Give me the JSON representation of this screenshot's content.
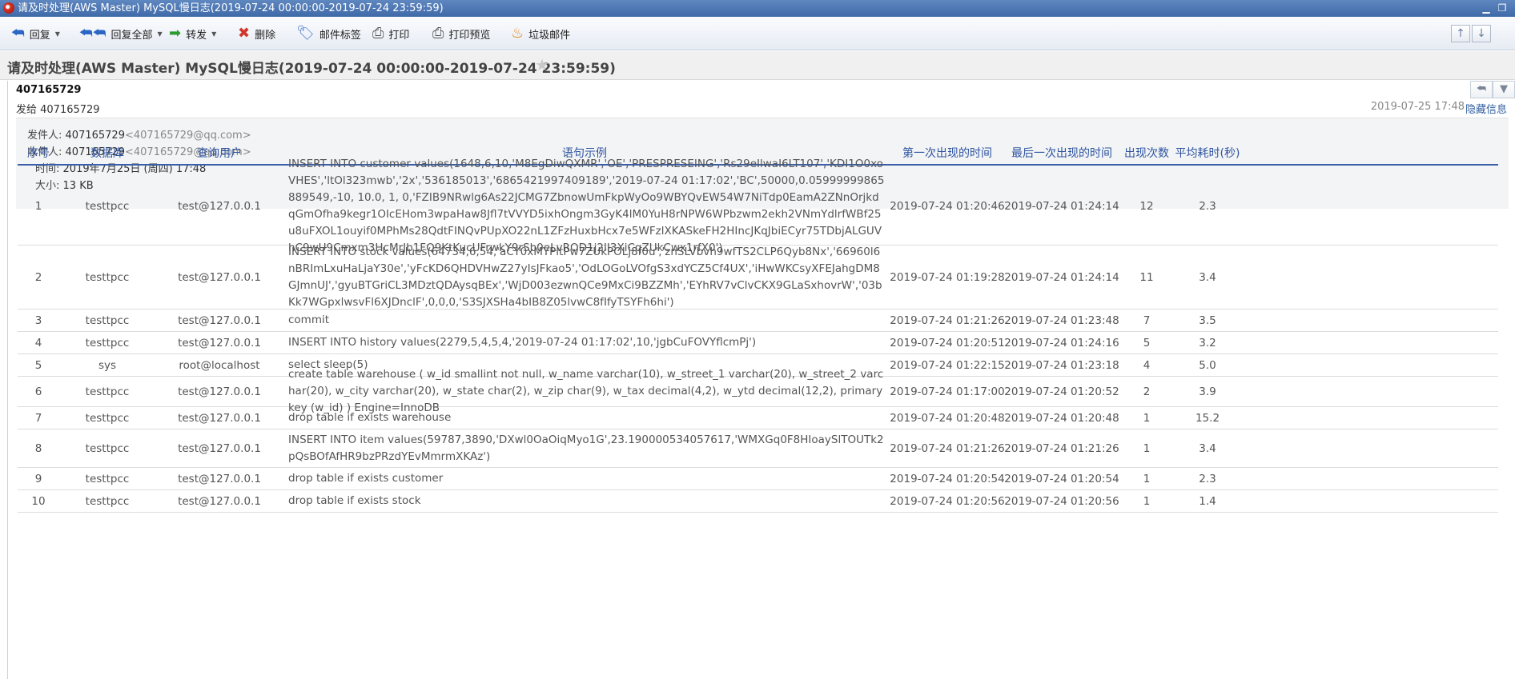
{
  "window": {
    "title": "请及时处理(AWS Master) MySQL慢日志(2019-07-24 00:00:00-2019-07-24 23:59:59)"
  },
  "toolbar": {
    "reply": "回复",
    "reply_all": "回复全部",
    "forward": "转发",
    "delete": "删除",
    "mail_tag": "邮件标签",
    "print": "打印",
    "print_preview": "打印预览",
    "spam": "垃圾邮件"
  },
  "subject": "请及时处理(AWS Master) MySQL慢日志(2019-07-24 00:00:00-2019-07-24 23:59:59)",
  "mail": {
    "sender_name": "407165729",
    "send_to": "发给 407165729",
    "date": "2019-07-25 17:48",
    "hide_info": "隐藏信息",
    "from_label": "发件人:",
    "from_name": "407165729",
    "from_addr": "<407165729@qq.com>",
    "to_label": "收件人:",
    "to_name": "407165729",
    "to_addr": "<407165729@qq.com>",
    "time_label": "时间:",
    "time_value": "2019年7月25日 (周四) 17:48",
    "size_label": "大小:",
    "size_value": "13 KB"
  },
  "table": {
    "headers": [
      "序号",
      "数据库",
      "查询用户",
      "语句示例",
      "第一次出现的时间",
      "最后一次出现的时间",
      "出现次数",
      "平均耗时(秒)"
    ],
    "rows": [
      {
        "no": "1",
        "db": "testtpcc",
        "user": "test@127.0.0.1",
        "sql": "INSERT INTO customer values(1648,6,10,'M8EgDiwQXMR','OE','PRESPRESEING','Rs29eIlwaI6LT107','KDI1O0xoVHES','ltOl323mwb','2x','536185013','6865421997409189','2019-07-24 01:17:02','BC',50000,0.05999999865889549,-10, 10.0, 1, 0,'FZIB9NRwlg6As22JCMG7ZbnowUmFkpWyOo9WBYQvEW54W7NiTdp0EamA2ZNnOrjkdqGmOfha9kegr1OIcEHom3wpaHaw8Jfl7tVVYD5ixhOngm3GyK4lM0YuH8rNPW6WPbzwm2ekh2VNmYdlrfWBf25u8uFXOL1ouyif0MPhMs28QdtFINQvPUpXO22nL1ZFzHuxbHcx7e5WFzlXKASkeFH2HIncJKqJbiECyr75TDbjALGUVhC9wU9Cmxm3HcMrJb1FQ9KtKucUFrwkY9rSb0eLvROD1j2II3XiCqZUkCwx1rfX0')",
        "first": "2019-07-24 01:20:46",
        "last": "2019-07-24 01:24:14",
        "count": "12",
        "avg": "2.3"
      },
      {
        "no": "2",
        "db": "testtpcc",
        "user": "test@127.0.0.1",
        "sql": "INSERT INTO stock values(64734,6,54,'aCY0xMYPltPw7ZUkPOLj8f0u','znSLVbvh9wfTS2CLP6Qyb8Nx','66960l6nBRImLxuHaLjaY30e','yFcKD6QHDVHwZ27yIsJFkao5','OdLOGoLVOfgS3xdYCZ5Cf4UX','iHwWKCsyXFEJahgDM8GJmnUJ','gyuBTGriCL3MDztQDAysqBEx','WjD003ezwnQCe9MxCi9BZZMh','EYhRV7vClvCKX9GLaSxhovrW','03bKk7WGpxlwsvFl6XJDnclF',0,0,0,'S3SJXSHa4bIB8Z05lvwC8fIfyTSYFh6hi')",
        "first": "2019-07-24 01:19:28",
        "last": "2019-07-24 01:24:14",
        "count": "11",
        "avg": "3.4"
      },
      {
        "no": "3",
        "db": "testtpcc",
        "user": "test@127.0.0.1",
        "sql": "commit",
        "first": "2019-07-24 01:21:26",
        "last": "2019-07-24 01:23:48",
        "count": "7",
        "avg": "3.5"
      },
      {
        "no": "4",
        "db": "testtpcc",
        "user": "test@127.0.0.1",
        "sql": "INSERT INTO history values(2279,5,4,5,4,'2019-07-24 01:17:02',10,'jgbCuFOVYflcmPj')",
        "first": "2019-07-24 01:20:51",
        "last": "2019-07-24 01:24:16",
        "count": "5",
        "avg": "3.2"
      },
      {
        "no": "5",
        "db": "sys",
        "user": "root@localhost",
        "sql": "select sleep(5)",
        "first": "2019-07-24 01:22:15",
        "last": "2019-07-24 01:23:18",
        "count": "4",
        "avg": "5.0"
      },
      {
        "no": "6",
        "db": "testtpcc",
        "user": "test@127.0.0.1",
        "sql": "create table warehouse ( w_id smallint not null, w_name varchar(10), w_street_1 varchar(20), w_street_2 varchar(20), w_city varchar(20), w_state char(2), w_zip char(9), w_tax decimal(4,2), w_ytd decimal(12,2), primary key (w_id) ) Engine=InnoDB",
        "first": "2019-07-24 01:17:00",
        "last": "2019-07-24 01:20:52",
        "count": "2",
        "avg": "3.9"
      },
      {
        "no": "7",
        "db": "testtpcc",
        "user": "test@127.0.0.1",
        "sql": "drop table if exists warehouse",
        "first": "2019-07-24 01:20:48",
        "last": "2019-07-24 01:20:48",
        "count": "1",
        "avg": "15.2"
      },
      {
        "no": "8",
        "db": "testtpcc",
        "user": "test@127.0.0.1",
        "sql": "INSERT INTO item values(59787,3890,'DXwl0OaOiqMyo1G',23.190000534057617,'WMXGq0F8HIoaySlTOUTk2pQsBOfAfHR9bzPRzdYEvMmrmXKAz')",
        "first": "2019-07-24 01:21:26",
        "last": "2019-07-24 01:21:26",
        "count": "1",
        "avg": "3.4"
      },
      {
        "no": "9",
        "db": "testtpcc",
        "user": "test@127.0.0.1",
        "sql": "drop table if exists customer",
        "first": "2019-07-24 01:20:54",
        "last": "2019-07-24 01:20:54",
        "count": "1",
        "avg": "2.3"
      },
      {
        "no": "10",
        "db": "testtpcc",
        "user": "test@127.0.0.1",
        "sql": "drop table if exists stock",
        "first": "2019-07-24 01:20:56",
        "last": "2019-07-24 01:20:56",
        "count": "1",
        "avg": "1.4"
      }
    ]
  },
  "colors": {
    "header_text": "#2e54a0",
    "header_rule": "#3b5fa8",
    "titlebar": "#4a75b3"
  },
  "icons": [
    "app-icon",
    "reply-icon",
    "reply-all-icon",
    "forward-icon",
    "delete-icon",
    "tag-icon",
    "print-icon",
    "print-preview-icon",
    "spam-icon",
    "star-icon",
    "arrow-up-icon",
    "arrow-down-icon",
    "minimize-icon",
    "restore-icon"
  ]
}
